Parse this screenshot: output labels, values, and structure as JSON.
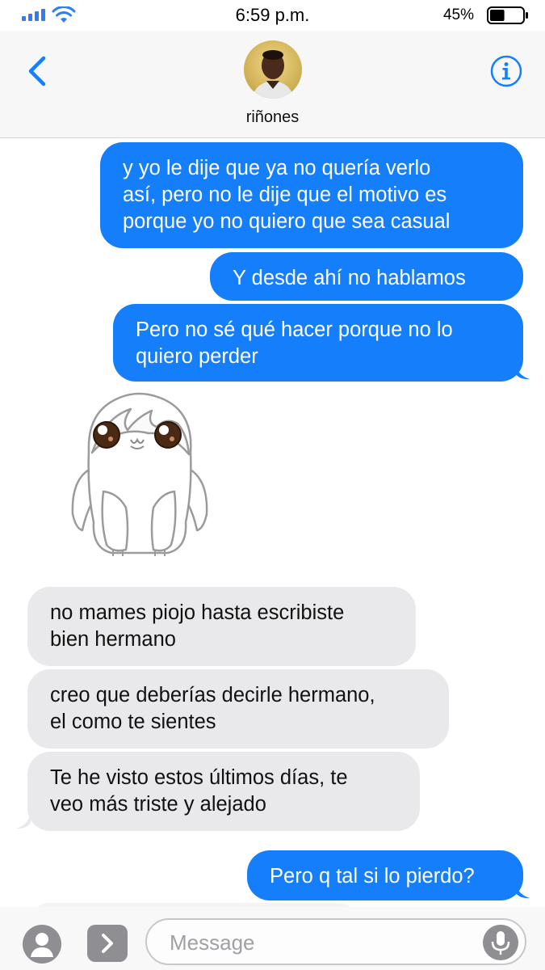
{
  "status_bar": {
    "time": "6:59 p.m.",
    "battery_percent": "45%",
    "battery_level": 0.45,
    "signal_bars": 4,
    "icons": [
      "signal-icon",
      "wifi-icon",
      "battery-icon"
    ]
  },
  "header": {
    "contact_name": "riñones",
    "icons": [
      "back-chevron-icon",
      "contact-avatar",
      "info-icon"
    ]
  },
  "messages": [
    {
      "direction": "outgoing",
      "lines": [
        "y yo le dije que ya no quería verlo",
        "así, pero no le dije que el motivo es",
        "porque yo no quiero que sea casual"
      ]
    },
    {
      "direction": "outgoing",
      "lines": [
        "Y desde ahí no hablamos"
      ]
    },
    {
      "direction": "outgoing",
      "lines": [
        "Pero no sé qué hacer porque no lo",
        "quiero perder"
      ]
    },
    {
      "direction": "incoming",
      "type": "sticker",
      "sticker": "sad-white-creature-sticker"
    },
    {
      "direction": "incoming",
      "lines": [
        "no mames piojo hasta escribiste",
        "bien hermano"
      ]
    },
    {
      "direction": "incoming",
      "lines": [
        "creo que deberías decirle hermano,",
        "el como te sientes"
      ]
    },
    {
      "direction": "incoming",
      "lines": [
        "Te he visto estos últimos días, te",
        "veo más triste y alejado"
      ]
    },
    {
      "direction": "outgoing",
      "lines": [
        "Pero q tal si lo pierdo?"
      ]
    }
  ],
  "input_bar": {
    "placeholder": "Message",
    "icons": [
      "camera-icon",
      "app-store-icon",
      "microphone-icon"
    ]
  },
  "colors": {
    "outgoing_bubble": "#147efb",
    "incoming_bubble": "#e9e9eb",
    "accent": "#147efb"
  }
}
